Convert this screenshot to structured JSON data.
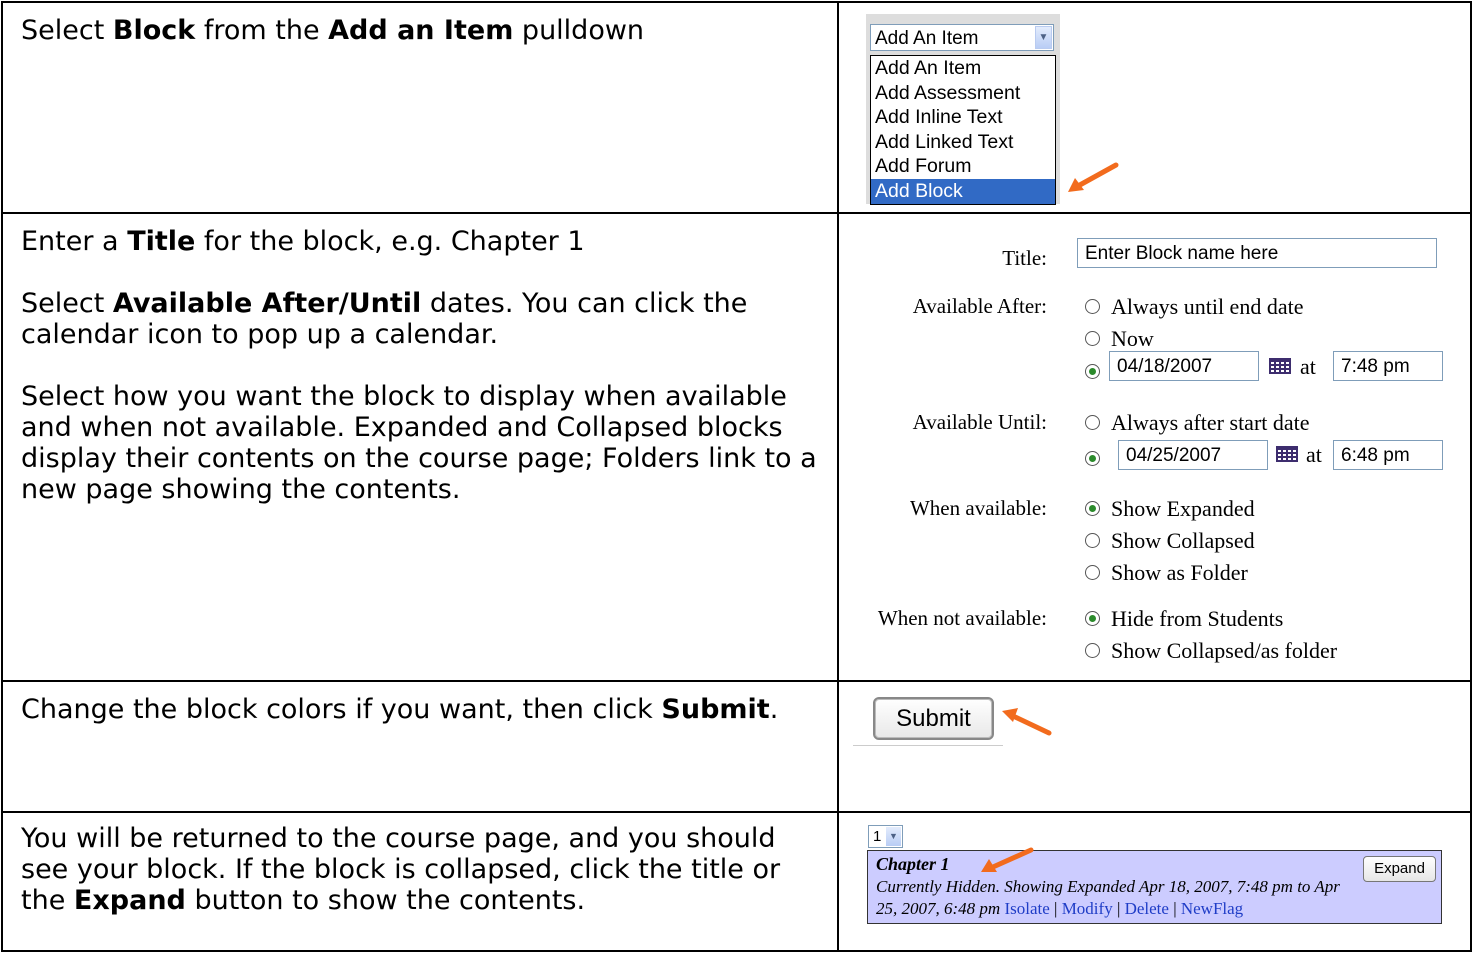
{
  "rows": [
    {
      "parts": [
        {
          "t": "Select "
        },
        {
          "t": "Block",
          "b": true
        },
        {
          "t": " from the "
        },
        {
          "t": "Add an Item",
          "b": true
        },
        {
          "t": " pulldown"
        }
      ]
    },
    {
      "paras": [
        [
          {
            "t": "Enter a "
          },
          {
            "t": "Title",
            "b": true
          },
          {
            "t": " for the block, e.g. Chapter 1"
          }
        ],
        [
          {
            "t": "Select "
          },
          {
            "t": "Available After/Until",
            "b": true
          },
          {
            "t": " dates.  You can click the calendar icon to pop up a calendar."
          }
        ],
        [
          {
            "t": "Select how you want the block to display when available and when not available.  Expanded and Collapsed blocks display their contents on the course page; Folders link to a new page showing the contents."
          }
        ]
      ]
    },
    {
      "parts": [
        {
          "t": "Change the block colors if you want, then click "
        },
        {
          "t": "Submit",
          "b": true
        },
        {
          "t": "."
        }
      ]
    },
    {
      "parts": [
        {
          "t": "You will be returned to the course page, and you should see your block.  If the block is collapsed, click the title or the "
        },
        {
          "t": "Expand",
          "b": true
        },
        {
          "t": " button to show the contents."
        }
      ]
    }
  ],
  "dropdown": {
    "selected": "Add An Item",
    "options": [
      "Add An Item",
      "Add Assessment",
      "Add Inline Text",
      "Add Linked Text",
      "Add Forum",
      "Add Block"
    ],
    "highlighted_index": 5
  },
  "form": {
    "title_label": "Title:",
    "title_value": "Enter Block name here",
    "after_label": "Available After:",
    "after_opt1": "Always until end date",
    "after_opt2": "Now",
    "after_date": "04/18/2007",
    "after_time": "7:48 pm",
    "until_label": "Available Until:",
    "until_opt1": "Always after start date",
    "until_date": "04/25/2007",
    "until_time": "6:48 pm",
    "at_text": "at",
    "when_label": "When available:",
    "when_opt1": "Show Expanded",
    "when_opt2": "Show Collapsed",
    "when_opt3": "Show as Folder",
    "notavail_label": "When not available:",
    "notavail_opt1": "Hide from Students",
    "notavail_opt2": "Show Collapsed/as folder"
  },
  "submit_label": "Submit",
  "course_block": {
    "page_select": "1",
    "title": "Chapter 1",
    "desc": "Currently Hidden. Showing Expanded Apr 18, 2007, 7:48 pm to Apr 25, 2007, 6:48 pm",
    "expand_label": "Expand",
    "links": [
      "Isolate",
      "Modify",
      "Delete",
      "NewFlag"
    ]
  },
  "colors": {
    "accent_arrow": "#f26b1d",
    "highlight": "#316ac5",
    "block_bg": "#ccccff",
    "link": "#1f3dc7"
  },
  "icons": [
    "chevron-down-icon",
    "calendar-icon",
    "arrow-pointer-icon",
    "radio-icon"
  ]
}
